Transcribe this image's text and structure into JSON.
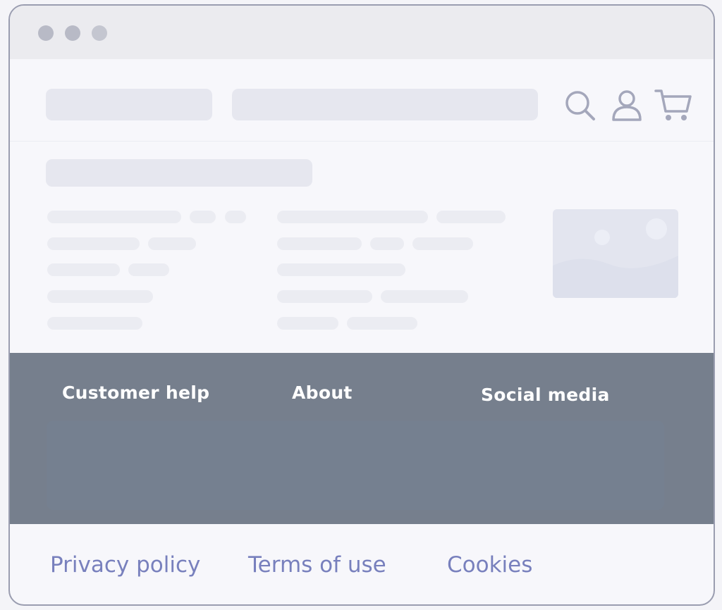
{
  "icons": {
    "search": "search-icon",
    "account": "user-icon",
    "cart": "cart-icon",
    "image_placeholder": "image-icon"
  },
  "footer": {
    "headings": [
      "Customer help",
      "About",
      "Social media"
    ]
  },
  "legal_links": [
    "Privacy policy",
    "Terms of use",
    "Cookies"
  ],
  "colors": {
    "footer_bg": "#767f8d",
    "legal_link": "#7880bd",
    "icon_stroke": "#a4a7bb"
  }
}
